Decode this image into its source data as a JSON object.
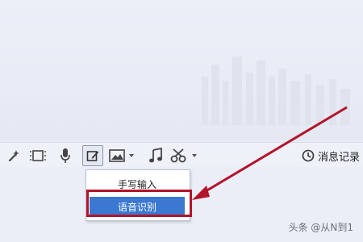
{
  "toolbar": {
    "icons": [
      {
        "name": "magic-wand-icon"
      },
      {
        "name": "screenshot-icon"
      },
      {
        "name": "microphone-icon"
      },
      {
        "name": "handwrite-edit-icon"
      },
      {
        "name": "image-icon"
      },
      {
        "name": "music-icon"
      },
      {
        "name": "scissors-icon"
      }
    ],
    "history_label": "消息记录"
  },
  "menu": {
    "items": [
      {
        "label": "手写输入"
      },
      {
        "label": "语音识别",
        "selected": true
      }
    ]
  },
  "watermark": {
    "text": "头条 @从N到1"
  },
  "colors": {
    "highlight": "#3a78d2",
    "annotation": "#b3142a"
  }
}
